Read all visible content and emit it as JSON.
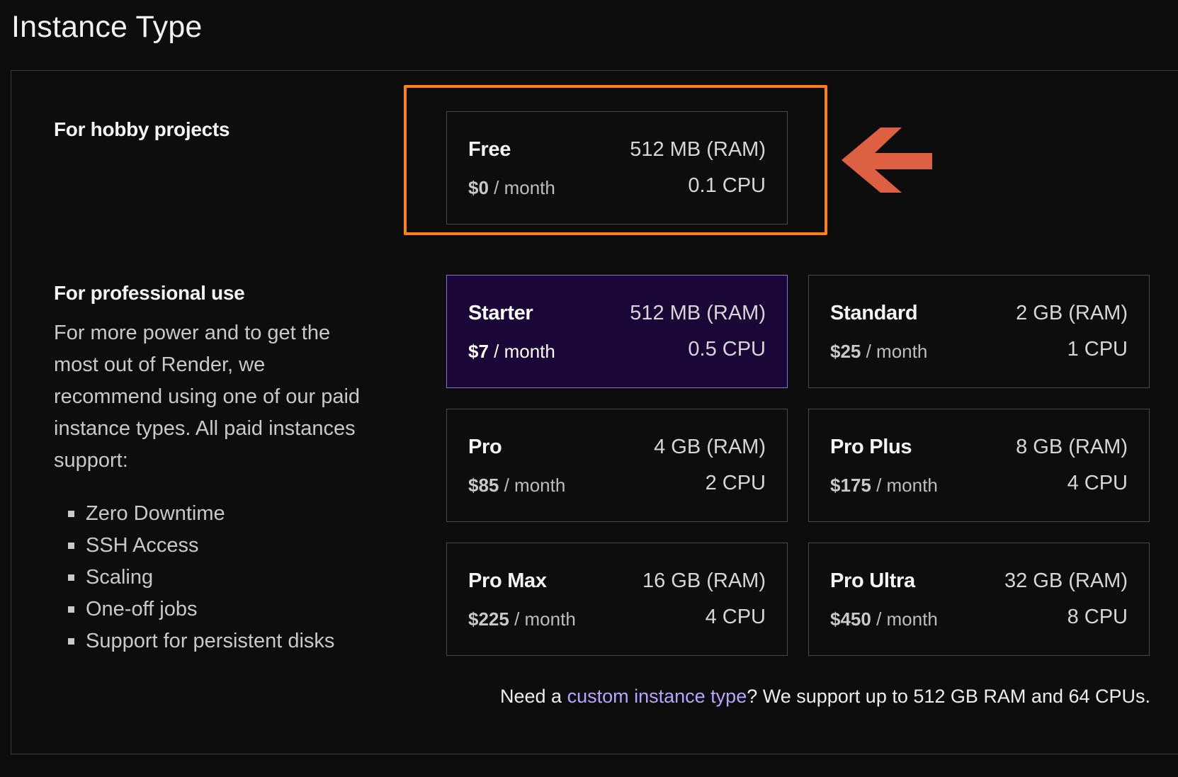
{
  "page": {
    "title": "Instance Type"
  },
  "hobby": {
    "heading": "For hobby projects",
    "plans": [
      {
        "name": "Free",
        "ram": "512 MB (RAM)",
        "price": "$0",
        "period": " / month",
        "cpu": "0.1 CPU"
      }
    ]
  },
  "professional": {
    "heading": "For professional use",
    "description": "For more power and to get the most out of Render, we recommend using one of our paid instance types. All paid instances support:",
    "features": [
      "Zero Downtime",
      "SSH Access",
      "Scaling",
      "One-off jobs",
      "Support for persistent disks"
    ],
    "plans": [
      {
        "name": "Starter",
        "ram": "512 MB (RAM)",
        "price": "$7",
        "period": " / month",
        "cpu": "0.5 CPU",
        "selected": true
      },
      {
        "name": "Standard",
        "ram": "2 GB (RAM)",
        "price": "$25",
        "period": " / month",
        "cpu": "1 CPU"
      },
      {
        "name": "Pro",
        "ram": "4 GB (RAM)",
        "price": "$85",
        "period": " / month",
        "cpu": "2 CPU"
      },
      {
        "name": "Pro Plus",
        "ram": "8 GB (RAM)",
        "price": "$175",
        "period": " / month",
        "cpu": "4 CPU"
      },
      {
        "name": "Pro Max",
        "ram": "16 GB (RAM)",
        "price": "$225",
        "period": " / month",
        "cpu": "4 CPU"
      },
      {
        "name": "Pro Ultra",
        "ram": "32 GB (RAM)",
        "price": "$450",
        "period": " / month",
        "cpu": "8 CPU"
      }
    ]
  },
  "footer": {
    "prefix": "Need a ",
    "link": "custom instance type",
    "suffix": "? We support up to 512 GB RAM and 64 CPUs."
  },
  "annotations": {
    "highlight_color": "#ff7e1f",
    "arrow_color": "#dd6042",
    "arrow_icon": "arrow-left-icon"
  },
  "colors": {
    "background": "#0d0d0d",
    "selected_card": "#1b0638",
    "selected_border": "#8d72d6",
    "link": "#b9a4ff"
  }
}
